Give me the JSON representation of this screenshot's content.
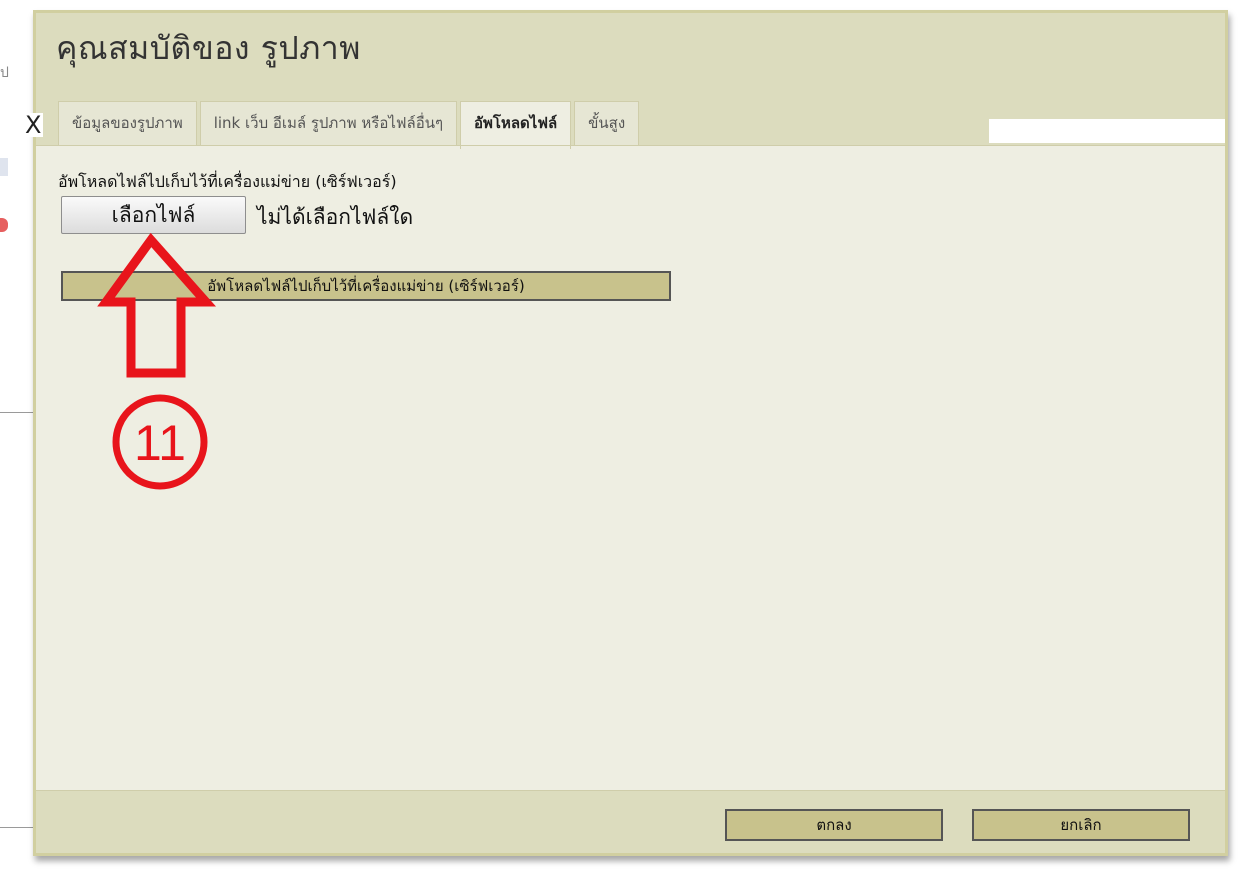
{
  "dialog": {
    "title": "คุณสมบัติของ รูปภาพ",
    "close_glyph": "X",
    "tabs": [
      {
        "label": "ข้อมูลของรูปภาพ"
      },
      {
        "label": "link เว็บ อีเมล์ รูปภาพ หรือไฟล์อื่นๆ"
      },
      {
        "label": "อัพโหลดไฟล์"
      },
      {
        "label": "ขั้นสูง"
      }
    ],
    "active_tab": "อัพโหลดไฟล์",
    "upload": {
      "label": "อัพโหลดไฟล์ไปเก็บไว้ที่เครื่องแม่ข่าย (เซิร์ฟเวอร์)",
      "choose_file_label": "เลือกไฟล์",
      "no_file_text": "ไม่ได้เลือกไฟล์ใด",
      "send_button_label": "อัพโหลดไฟล์ไปเก็บไว้ที่เครื่องแม่ข่าย (เซิร์ฟเวอร์)"
    },
    "footer": {
      "ok_label": "ตกลง",
      "cancel_label": "ยกเลิก"
    }
  },
  "annotation": {
    "step_number": "11",
    "color": "#e8141b"
  },
  "colors": {
    "dialog_bg": "#eeeee2",
    "titlebar_bg": "#dcdcbe",
    "button_bg": "#c8c28c"
  }
}
